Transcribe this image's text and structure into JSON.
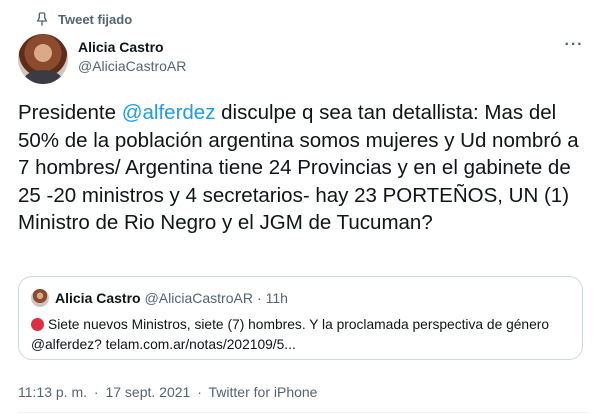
{
  "pinned": {
    "icon": "pin-icon",
    "label": "Tweet fijado"
  },
  "author": {
    "name": "Alicia Castro",
    "handle": "@AliciaCastroAR"
  },
  "more_icon": "more-icon",
  "tweet": {
    "text_before": "Presidente ",
    "mention": "@alferdez",
    "text_after": " disculpe q sea tan detallista: Mas del 50% de la población argentina somos mujeres y Ud nombró a 7 hombres/ Argentina tiene 24 Provincias y en el gabinete de 25 -20 ministros y 4 secretarios- hay 23 PORTEÑOS, UN (1) Ministro de Rio Negro y el JGM de Tucuman?"
  },
  "quoted": {
    "name": "Alicia Castro",
    "handle": "@AliciaCastroAR",
    "dot": "·",
    "time": "11h",
    "emoji_icon": "red-circle-icon",
    "text": "Siete nuevos Ministros, siete (7) hombres. Y la proclamada perspectiva de género @alferdez? telam.com.ar/notas/202109/5..."
  },
  "meta": {
    "time": "11:13 p. m.",
    "sep1": "·",
    "date": "17 sept. 2021",
    "sep2": "·",
    "source": "Twitter for iPhone"
  },
  "colors": {
    "accent": "#1d9bf0",
    "secondary_text": "#536471",
    "border": "#cfd9de",
    "red_circle": "#dd2e44"
  }
}
